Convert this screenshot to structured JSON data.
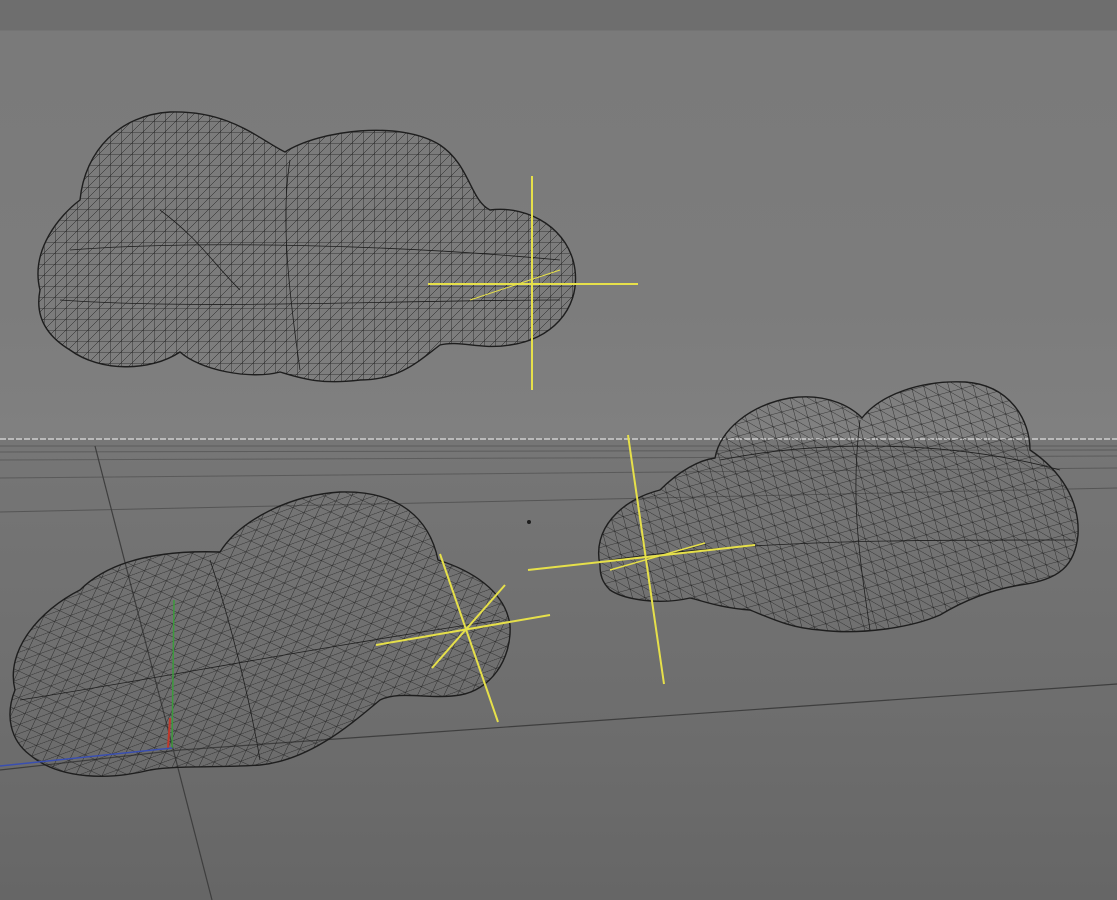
{
  "viewport": {
    "view": "perspective",
    "display_mode": "wireframe",
    "colors": {
      "background_top": "#7a7a7a",
      "background_bottom": "#666666",
      "horizon": "#cfcfcf",
      "wire": "#1e1e1e",
      "null_axis": "#e6e04a",
      "axis_x": "#c0392b",
      "axis_y": "#3c9a3c",
      "axis_z": "#3a4fb0",
      "grid": "#5a5a5a"
    }
  },
  "objects": [
    {
      "name": "cloud-1",
      "type": "polygon-mesh",
      "shape": "cloud-shape",
      "has_null_axis": true
    },
    {
      "name": "cloud-2",
      "type": "polygon-mesh",
      "shape": "cloud-shape",
      "has_null_axis": true
    },
    {
      "name": "cloud-3",
      "type": "polygon-mesh",
      "shape": "cloud-shape",
      "has_null_axis": true
    }
  ],
  "icons": {
    "null_axis": "null-axis-icon",
    "world_axis": "world-axis-icon",
    "pivot": "pivot-point-icon"
  }
}
